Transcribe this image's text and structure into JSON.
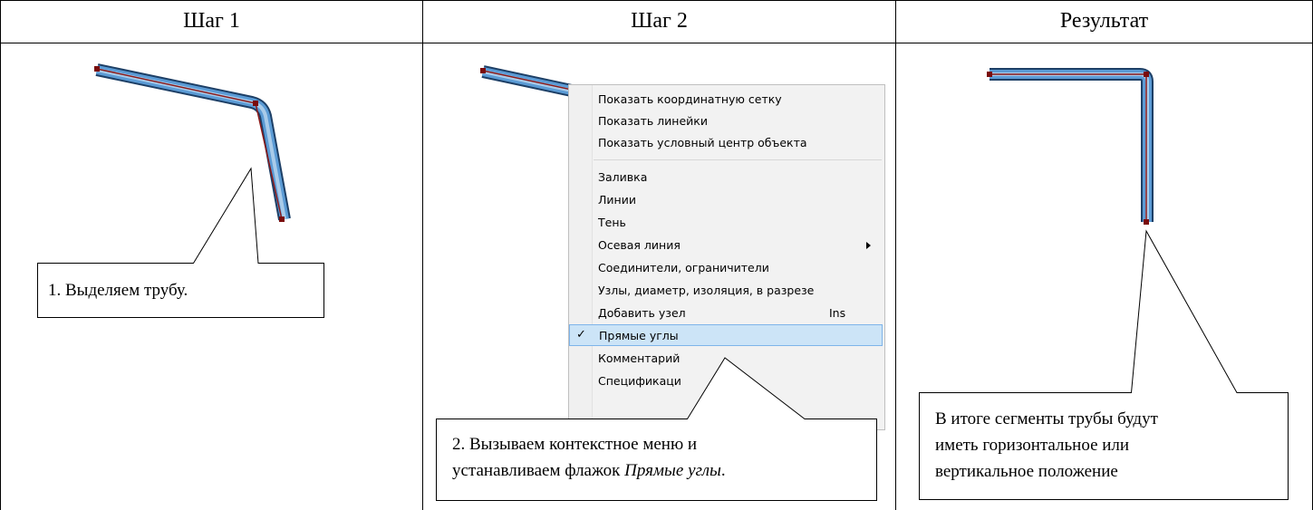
{
  "table": {
    "headers": [
      "Шаг 1",
      "Шаг 2",
      "Результат"
    ]
  },
  "callouts": {
    "step1": "1. Выделяем трубу.",
    "step2_line1": "2. Вызываем контекстное меню и",
    "step2_line2_prefix": "устанавливаем флажок ",
    "step2_line2_italic": "Прямые углы",
    "step2_line2_suffix": ".",
    "result_line1": "В итоге сегменты трубы будут",
    "result_line2": "иметь горизонтальное или",
    "result_line3": "вертикальное положение"
  },
  "context_menu": {
    "items": [
      {
        "label": "Показать координатную сетку"
      },
      {
        "label": "Показать линейки"
      },
      {
        "label": "Показать условный центр объекта"
      },
      {
        "label": "Заливка"
      },
      {
        "label": "Линии"
      },
      {
        "label": "Тень"
      },
      {
        "label": "Осевая линия",
        "submenu": true
      },
      {
        "label": "Соединители, ограничители"
      },
      {
        "label": "Узлы, диаметр, изоляция, в разрезе"
      },
      {
        "label": "Добавить узел",
        "shortcut": "Ins"
      },
      {
        "label": "Прямые углы",
        "checked": true,
        "selected": true
      },
      {
        "label": "Комментарий"
      },
      {
        "label": "Спецификаци"
      }
    ]
  },
  "colors": {
    "pipe_outline": "#1d3f66",
    "pipe_fill": "#5b9bd5",
    "pipe_light": "#bdd7ee",
    "pipe_axis": "#8b1a1a",
    "node": "#7a0c0c",
    "menu_highlight": "#cce4f7"
  }
}
